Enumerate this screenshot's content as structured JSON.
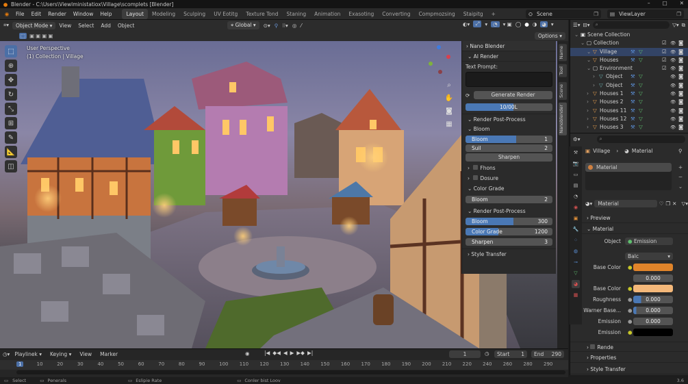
{
  "window": {
    "title": "Blender - C:\\Users\\Viewlministatiox\\Village\\scomplets [Blender]"
  },
  "menu": [
    "File",
    "Edit",
    "Render",
    "Window",
    "Help"
  ],
  "workspaces": [
    "Layout",
    "Modeling",
    "Sculping",
    "UV Eotitg",
    "Texture Tond",
    "Staning",
    "Animation",
    "Exasoting",
    "Converting",
    "Compmozsing",
    "Staipitg"
  ],
  "active_workspace": "Layout",
  "scene": "Scene",
  "view_layer": "ViewLayer",
  "viewport_header": {
    "mode": "Object Mode",
    "view": "View",
    "select": "Select",
    "add": "Add",
    "object": "Object",
    "transform": "Global",
    "options": "Options"
  },
  "viewport": {
    "line1": "User Perspective",
    "line2": "(1) Collection | Village"
  },
  "npanel": {
    "title": "Nano Blender",
    "ai_render": "AI Render",
    "text_prompt_label": "Text Prompt:",
    "text_prompt_value": "",
    "generate_button": "Generate Render",
    "progress_label": "10/00L",
    "progress_fraction": 0.55,
    "render_post_process": "Render Post-Process",
    "bloom_header": "Bloom",
    "bloom_slider": {
      "label": "Bloom",
      "value": "1",
      "fraction": 0.58
    },
    "suil": {
      "label": "Suil",
      "value": "2"
    },
    "sharpen_button": "Sharpen",
    "fhons": "Fhons",
    "dosure": "Dosure",
    "color_grade_header": "Color Grade",
    "cg_bloom": {
      "label": "Bloom",
      "value": "2"
    },
    "rpp2_header": "Render Post-Process",
    "rpp2_bloom": {
      "label": "Bloom",
      "value": "300",
      "fraction": 0.55
    },
    "rpp2_color_grade": {
      "label": "Color Grade",
      "value": "1200",
      "fraction": 0.38
    },
    "rpp2_sharpen": {
      "label": "Sharpen",
      "value": "3"
    },
    "style_transfer": "Style Transfer"
  },
  "side_tabs": [
    "Name",
    "Tool",
    "Scene",
    "Nanoblender"
  ],
  "outliner": {
    "items": [
      {
        "name": "Scene Collection",
        "indent": 0
      },
      {
        "name": "Collection",
        "indent": 1
      },
      {
        "name": "Village",
        "indent": 2
      },
      {
        "name": "Houses",
        "indent": 2
      },
      {
        "name": "Environment",
        "indent": 2
      },
      {
        "name": "Object",
        "indent": 3
      },
      {
        "name": "Object",
        "indent": 3
      },
      {
        "name": "Houses 1",
        "indent": 2
      },
      {
        "name": "Houses 2",
        "indent": 2
      },
      {
        "name": "Houses 11",
        "indent": 2
      },
      {
        "name": "Houses 12",
        "indent": 2
      },
      {
        "name": "Houses 3",
        "indent": 2
      }
    ]
  },
  "properties": {
    "breadcrumb_object": "Village",
    "breadcrumb_material": "Material",
    "slot": "Material",
    "material_name": "Material",
    "preview": "Preview",
    "material_section": "Material",
    "object_label": "Object",
    "object_value": "Emission",
    "dropdown_value": "Balc",
    "base_color_label": "Base Color",
    "base_color_hex": "#e0842a",
    "value_1": "0.000",
    "base_color2_label": "Base Color",
    "base_color2_hex": "#f4b87a",
    "roughness_label": "Roughness",
    "roughness_value": "0.000",
    "warner_label": "Warner Base...",
    "warner_value": "0.000",
    "emission_label": "Emission",
    "emission_value": "0.000",
    "emission2_label": "Emission",
    "emission2_hex": "#000000",
    "rende": "Rende",
    "properties_section": "Properties",
    "style_transfer": "Style Transfer"
  },
  "timeline": {
    "playback": "Playlinek",
    "keying": "Keying",
    "view": "View",
    "marker": "Marker",
    "current_frame": "1",
    "start_label": "Start",
    "start_value": "1",
    "end_label": "End",
    "end_value": "290",
    "ticks": [
      "1",
      "10",
      "20",
      "30",
      "40",
      "50",
      "60",
      "70",
      "80",
      "90",
      "100",
      "110",
      "120",
      "130",
      "140",
      "150",
      "160",
      "170",
      "180",
      "190",
      "200",
      "210",
      "220",
      "240",
      "260",
      "280",
      "290"
    ]
  },
  "status": {
    "select": "Select",
    "s2": "Penerals",
    "s3": "Eslipie Rate",
    "s4": "Conler bist Loov",
    "version": "3.6"
  }
}
